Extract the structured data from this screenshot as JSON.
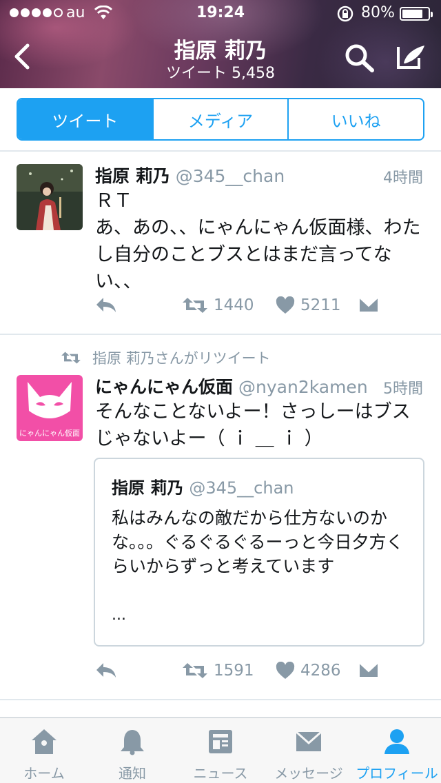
{
  "status_bar": {
    "carrier": "au",
    "time": "19:24",
    "battery_percent": "80%",
    "battery_level": 0.8
  },
  "header": {
    "title": "指原 莉乃",
    "subtitle": "ツイート 5,458"
  },
  "segments": [
    {
      "label": "ツイート",
      "selected": true
    },
    {
      "label": "メディア",
      "selected": false
    },
    {
      "label": "いいね",
      "selected": false
    }
  ],
  "tweets": [
    {
      "name": "指原 莉乃",
      "handle": "@345__chan",
      "time": "4時間",
      "text_line1": "ＲＴ",
      "text_line2": "あ、あの、、にゃんにゃん仮面様、わたし自分のことブスとはまだ言ってない、、",
      "retweets": "1440",
      "likes": "5211"
    },
    {
      "retweeted_by": "指原 莉乃さんがリツイート",
      "name": "にゃんにゃん仮面",
      "handle": "@nyan2kamen",
      "time": "5時間",
      "text": "そんなことないよー！さっしーはブスじゃないよー（ ｉ ＿ ｉ ）",
      "avatar_text": "にゃんにゃん仮面",
      "quote": {
        "name": "指原 莉乃",
        "handle": "@345__chan",
        "text": "私はみんなの敵だから仕方ないのかな。。。ぐるぐるぐるーっと今日夕方くらいからずっと考えています",
        "ellipsis": "..."
      },
      "retweets": "1591",
      "likes": "4286"
    }
  ],
  "tabbar": [
    {
      "label": "ホーム",
      "icon": "home-icon",
      "active": false
    },
    {
      "label": "通知",
      "icon": "bell-icon",
      "active": false
    },
    {
      "label": "ニュース",
      "icon": "news-icon",
      "active": false
    },
    {
      "label": "メッセージ",
      "icon": "envelope-icon",
      "active": false
    },
    {
      "label": "プロフィール",
      "icon": "person-icon",
      "active": true
    }
  ],
  "colors": {
    "accent": "#1da1f2",
    "muted": "#8899a6",
    "text": "#14171a"
  }
}
